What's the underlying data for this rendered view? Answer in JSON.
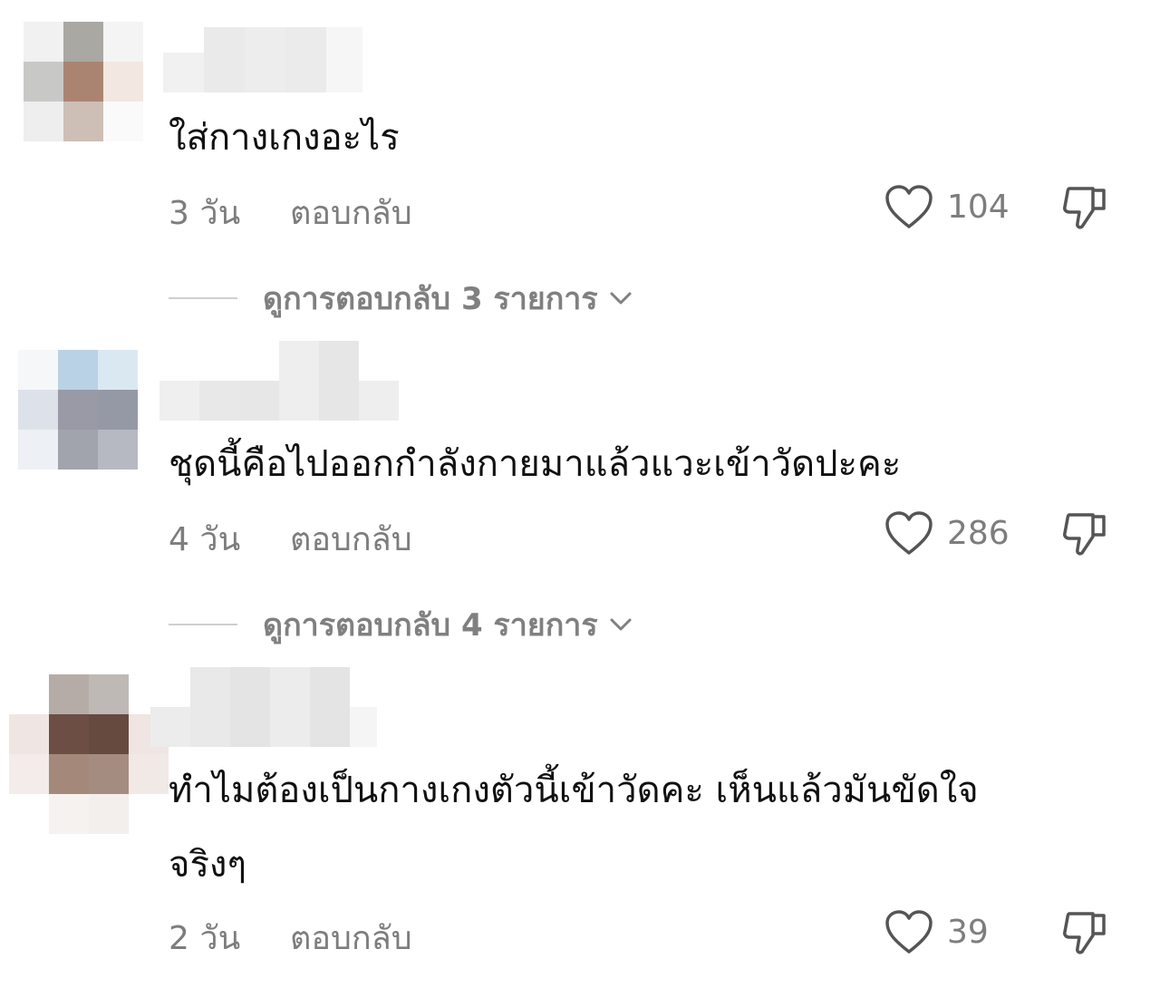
{
  "comments": [
    {
      "text": "ใส่กางเกงอะไร",
      "time": "3 วัน",
      "reply_label": "ตอบกลับ",
      "likes": "104",
      "view_replies": "ดูการตอบกลับ 3 รายการ"
    },
    {
      "text": "ชุดนี้คือไปออกกำลังกายมาแล้วแวะเข้าวัดปะคะ",
      "time": "4 วัน",
      "reply_label": "ตอบกลับ",
      "likes": "286",
      "view_replies": "ดูการตอบกลับ 4 รายการ"
    },
    {
      "text_line1": "ทำไมต้องเป็นกางเกงตัวนี้เข้าวัดคะ เห็นแล้วมันขัดใจ",
      "text_line2": "จริงๆ",
      "time": "2 วัน",
      "reply_label": "ตอบกลับ",
      "likes": "39"
    }
  ],
  "icons": {
    "like": "heart-icon",
    "dislike": "thumbs-down-icon",
    "expand": "chevron-down-icon"
  },
  "colors": {
    "text": "#111111",
    "meta": "#7d7d7d",
    "line": "#cfcfcf"
  }
}
